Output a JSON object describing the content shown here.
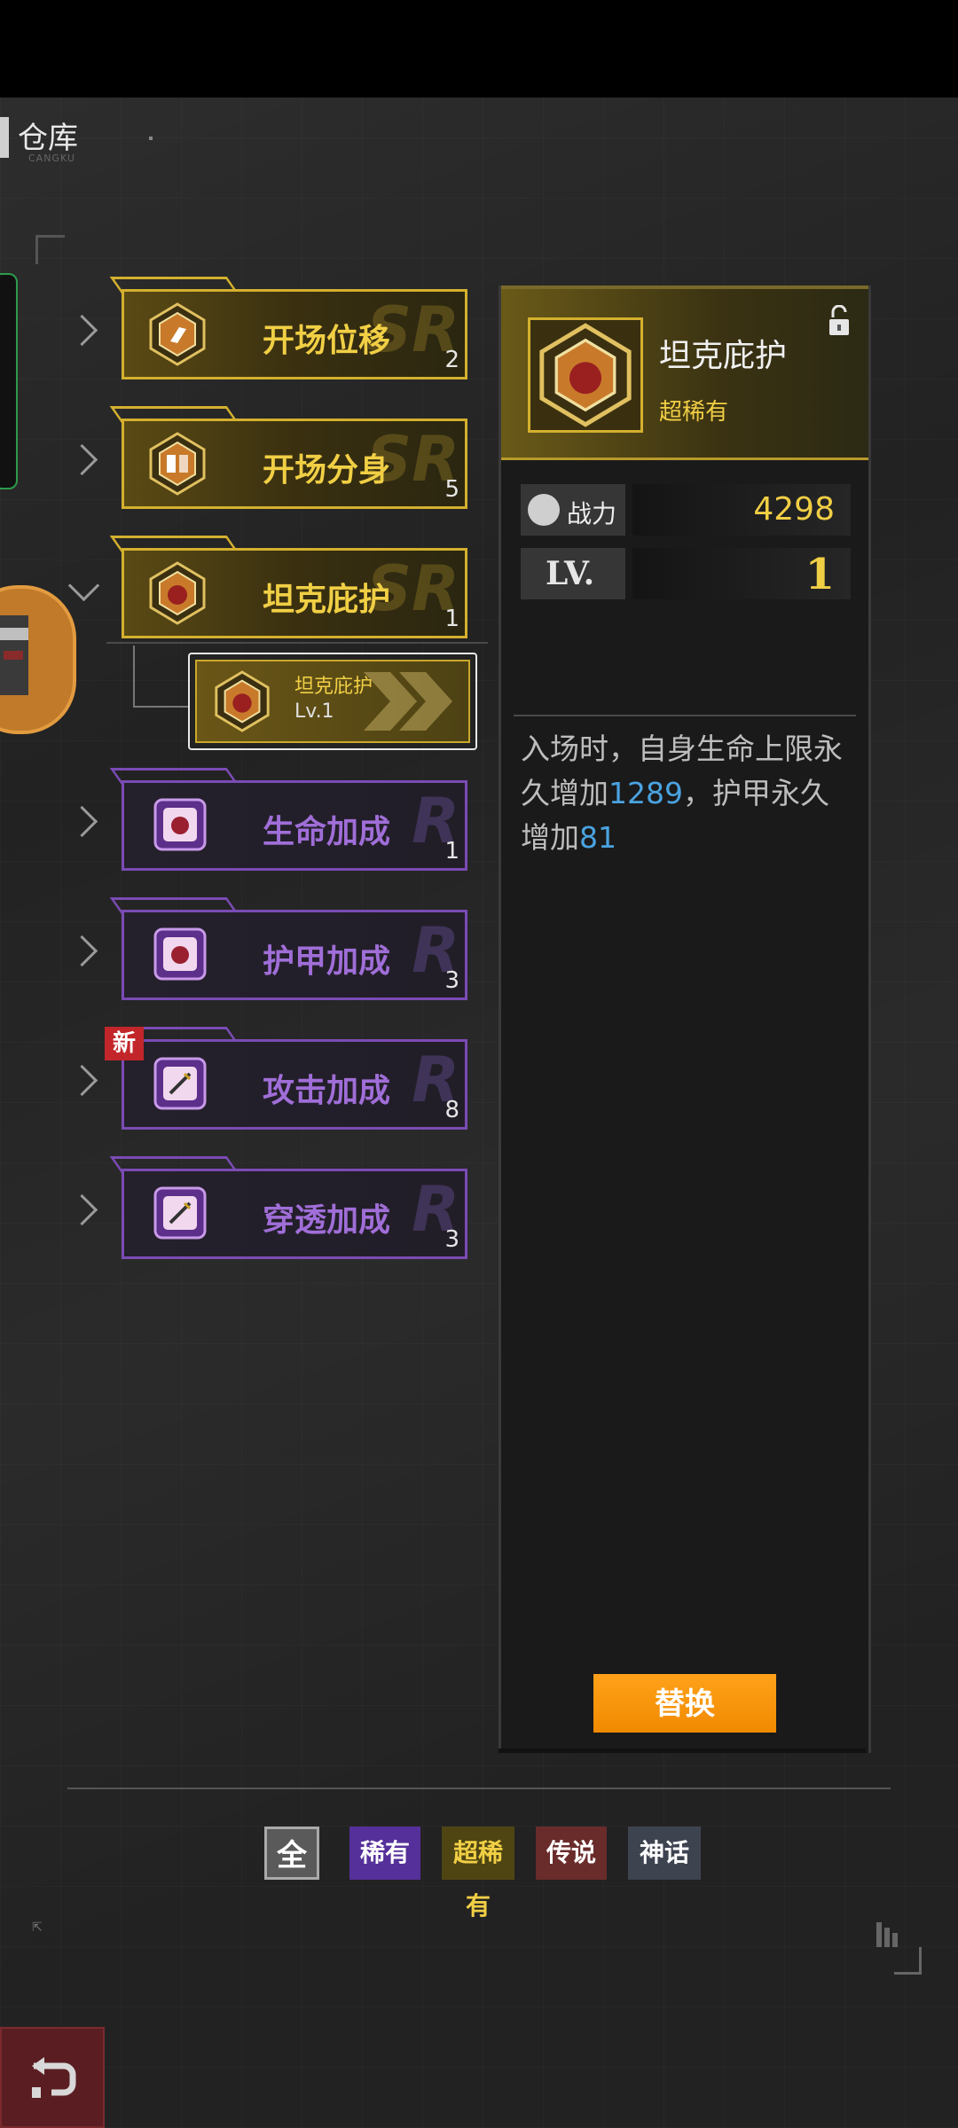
{
  "header": {
    "title": "仓库",
    "subtitle": "CANGKU"
  },
  "skills": [
    {
      "name": "开场位移",
      "count": "2",
      "rarity": "gold",
      "watermark": "SR",
      "expanded": false
    },
    {
      "name": "开场分身",
      "count": "5",
      "rarity": "gold",
      "watermark": "SR",
      "expanded": false
    },
    {
      "name": "坦克庇护",
      "count": "1",
      "rarity": "gold",
      "watermark": "SR",
      "expanded": true
    },
    {
      "name": "生命加成",
      "count": "1",
      "rarity": "purple",
      "watermark": "R",
      "expanded": false
    },
    {
      "name": "护甲加成",
      "count": "3",
      "rarity": "purple",
      "watermark": "R",
      "expanded": false
    },
    {
      "name": "攻击加成",
      "count": "8",
      "rarity": "purple",
      "watermark": "R",
      "expanded": false,
      "badge": "新"
    },
    {
      "name": "穿透加成",
      "count": "3",
      "rarity": "purple",
      "watermark": "R",
      "expanded": false
    }
  ],
  "sub_item": {
    "name": "坦克庇护",
    "level": "Lv.1"
  },
  "detail": {
    "name": "坦克庇护",
    "rarity": "超稀有",
    "power_label": "战力",
    "power_value": "4298",
    "level_label": "LV.",
    "level_value": "1",
    "desc_part1": "入场时，自身生命上限永久增加",
    "desc_num1": "1289",
    "desc_part2": "，护甲永久增加",
    "desc_num2": "81",
    "replace_label": "替换"
  },
  "filters": {
    "all": "全",
    "rare": "稀有",
    "super_rare": "超稀有",
    "legend": "传说",
    "myth": "神话"
  },
  "colors": {
    "gold": "#d4b02e",
    "purple": "#7b4bb5",
    "highlight": "#4aa3e0",
    "button": "#f79a0c"
  },
  "icons": {
    "back": "back-arrow-icon",
    "lock": "unlock-icon",
    "power": "fist-icon"
  }
}
